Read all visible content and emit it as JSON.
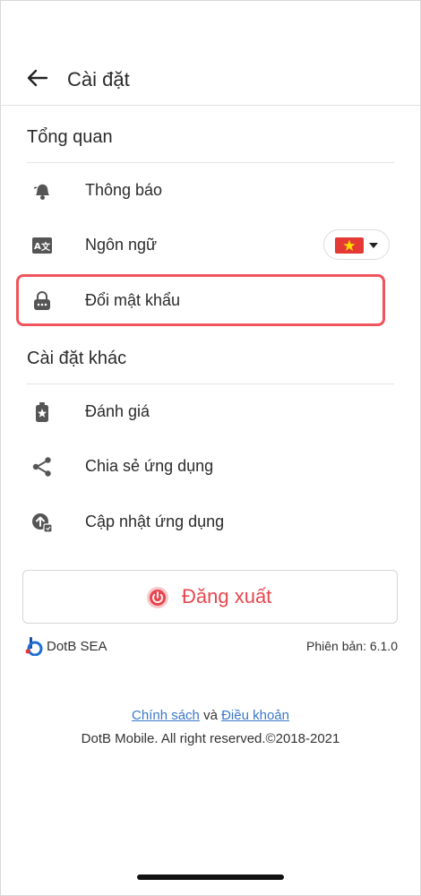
{
  "header": {
    "title": "Cài đặt"
  },
  "sections": {
    "general": {
      "title": "Tổng quan",
      "items": [
        {
          "label": "Thông báo",
          "icon": "bell-icon"
        },
        {
          "label": "Ngôn ngữ",
          "icon": "translate-icon"
        },
        {
          "label": "Đổi mật khẩu",
          "icon": "lock-icon"
        }
      ]
    },
    "other": {
      "title": "Cài đặt khác",
      "items": [
        {
          "label": "Đánh giá",
          "icon": "rate-icon"
        },
        {
          "label": "Chia sẻ ứng dụng",
          "icon": "share-icon"
        },
        {
          "label": "Cập nhật ứng dụng",
          "icon": "update-icon"
        }
      ]
    }
  },
  "language": {
    "selected": "vn-flag-icon"
  },
  "logout": {
    "label": "Đăng xuất"
  },
  "footer": {
    "brand": "DotB SEA",
    "version": "Phiên bản: 6.1.0",
    "policy": "Chính sách",
    "and": "và",
    "terms": "Điều khoản",
    "copyright": "DotB Mobile. All right reserved.©2018-2021"
  },
  "colors": {
    "accent": "#e8474f",
    "link": "#3a78c9",
    "highlight": "#f0545c"
  }
}
